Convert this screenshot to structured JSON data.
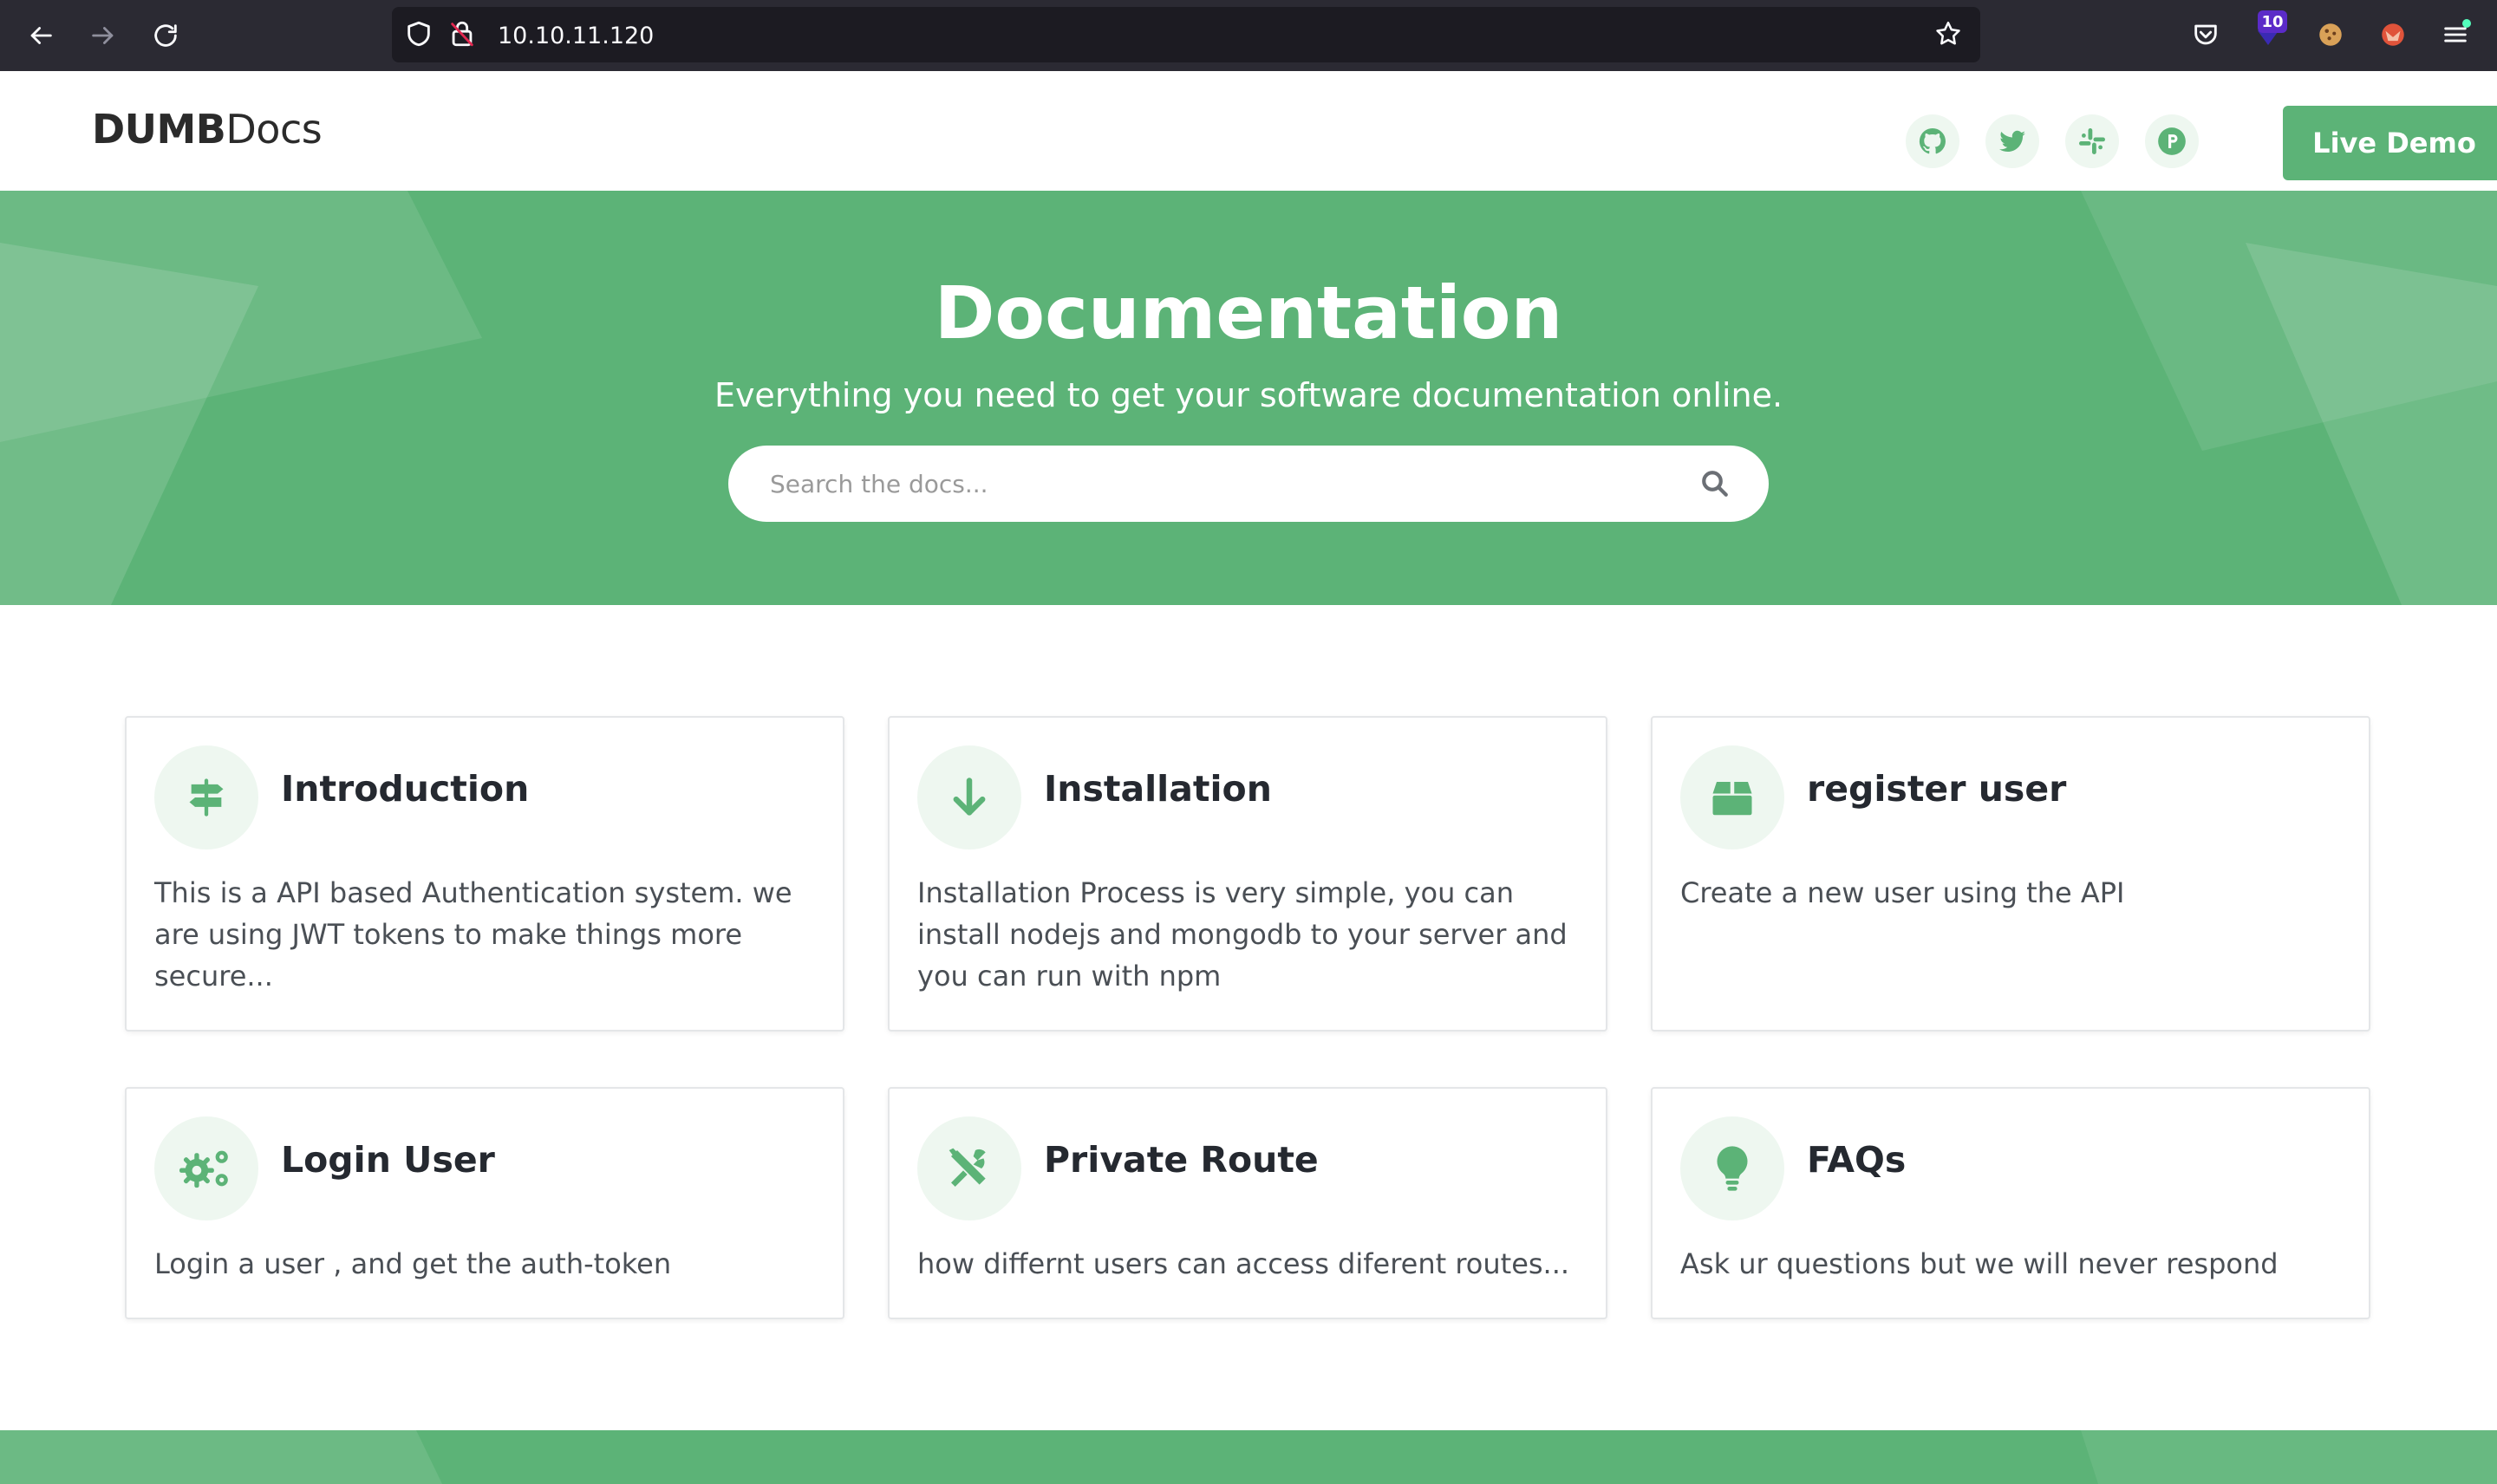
{
  "browser": {
    "url": "10.10.11.120",
    "extension_badge": "10"
  },
  "header": {
    "logo_bold": "DUMB",
    "logo_light": "Docs",
    "social": [
      "github-icon",
      "twitter-icon",
      "slack-icon",
      "product-hunt-icon"
    ],
    "live_demo_label": "Live Demo"
  },
  "hero": {
    "title": "Documentation",
    "subtitle": "Everything you need to get your software documentation online.",
    "search_placeholder": "Search the docs..."
  },
  "cards": [
    {
      "title": "Introduction",
      "text": "This is a API based Authentication system. we are using JWT tokens to make things more secure...",
      "icon": "signpost-icon"
    },
    {
      "title": "Installation",
      "text": "Installation Process is very simple, you can install nodejs and mongodb to your server and you can run with npm",
      "icon": "arrow-down-icon"
    },
    {
      "title": "register user",
      "text": "Create a new user using the API",
      "icon": "box-icon"
    },
    {
      "title": "Login User",
      "text": "Login a user , and get the auth-token",
      "icon": "cogs-icon"
    },
    {
      "title": "Private Route",
      "text": "how differnt users can access diferent routes...",
      "icon": "tools-icon"
    },
    {
      "title": "FAQs",
      "text": "Ask ur questions but we will never respond",
      "icon": "lightbulb-icon"
    }
  ],
  "colors": {
    "brand_green": "#5cb377",
    "icon_bg": "#eef7f0",
    "browser_bar": "#2b2a33",
    "urlbar": "#1c1b22"
  }
}
